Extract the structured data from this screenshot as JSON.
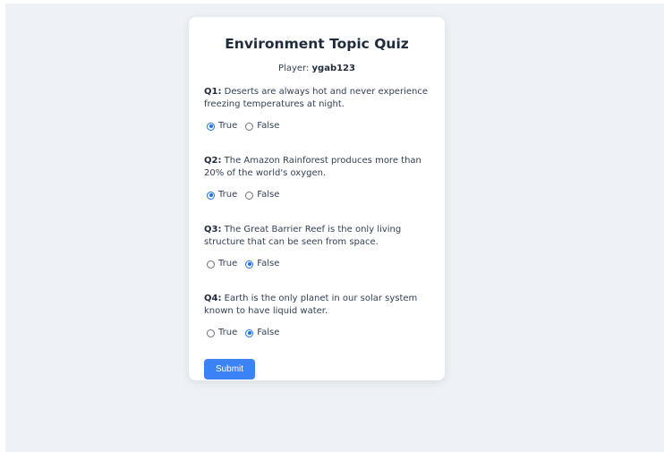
{
  "quiz": {
    "title": "Environment Topic Quiz",
    "player_label": "Player:",
    "player_name": "ygab123",
    "submit_label": "Submit",
    "option_true": "True",
    "option_false": "False",
    "accent_color": "#3b82f6",
    "questions": [
      {
        "number": "Q1:",
        "text": "Deserts are always hot and never experience freezing temperatures at night.",
        "selected": "True"
      },
      {
        "number": "Q2:",
        "text": "The Amazon Rainforest produces more than 20% of the world's oxygen.",
        "selected": "True"
      },
      {
        "number": "Q3:",
        "text": "The Great Barrier Reef is the only living structure that can be seen from space.",
        "selected": "False"
      },
      {
        "number": "Q4:",
        "text": "Earth is the only planet in our solar system known to have liquid water.",
        "selected": "False"
      }
    ]
  }
}
